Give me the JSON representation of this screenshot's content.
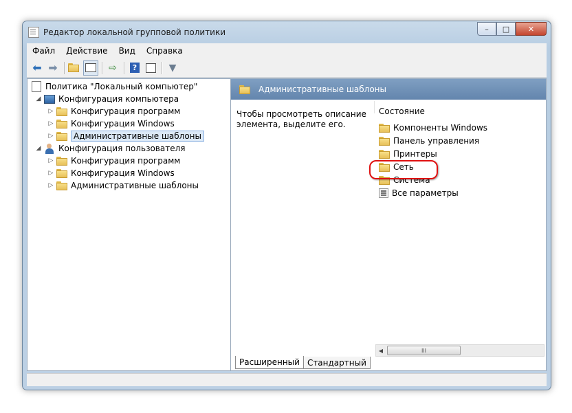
{
  "window": {
    "title": "Редактор локальной групповой политики"
  },
  "menu": [
    {
      "label": "Файл"
    },
    {
      "label": "Действие"
    },
    {
      "label": "Вид"
    },
    {
      "label": "Справка"
    }
  ],
  "toolbar": {
    "buttons": [
      "back-icon",
      "forward-icon",
      "up-folder-icon",
      "show-hide-tree-icon",
      "export-list-icon",
      "help-icon",
      "properties-icon",
      "filter-icon"
    ]
  },
  "tree": {
    "root": "Политика \"Локальный компьютер\"",
    "computer_config": "Конфигурация компьютера",
    "cc_programs": "Конфигурация программ",
    "cc_windows": "Конфигурация Windows",
    "cc_admin_templates": "Административные шаблоны",
    "user_config": "Конфигурация пользователя",
    "uc_programs": "Конфигурация программ",
    "uc_windows": "Конфигурация Windows",
    "uc_admin_templates": "Административные шаблоны"
  },
  "details": {
    "header": "Административные шаблоны",
    "description": "Чтобы просмотреть описание элемента, выделите его.",
    "column_header": "Состояние",
    "items": [
      "Компоненты Windows",
      "Панель управления",
      "Принтеры",
      "Сеть",
      "Система",
      "Все параметры"
    ],
    "scroll_label": "III"
  },
  "tabs": {
    "extended": "Расширенный",
    "standard": "Стандартный"
  }
}
